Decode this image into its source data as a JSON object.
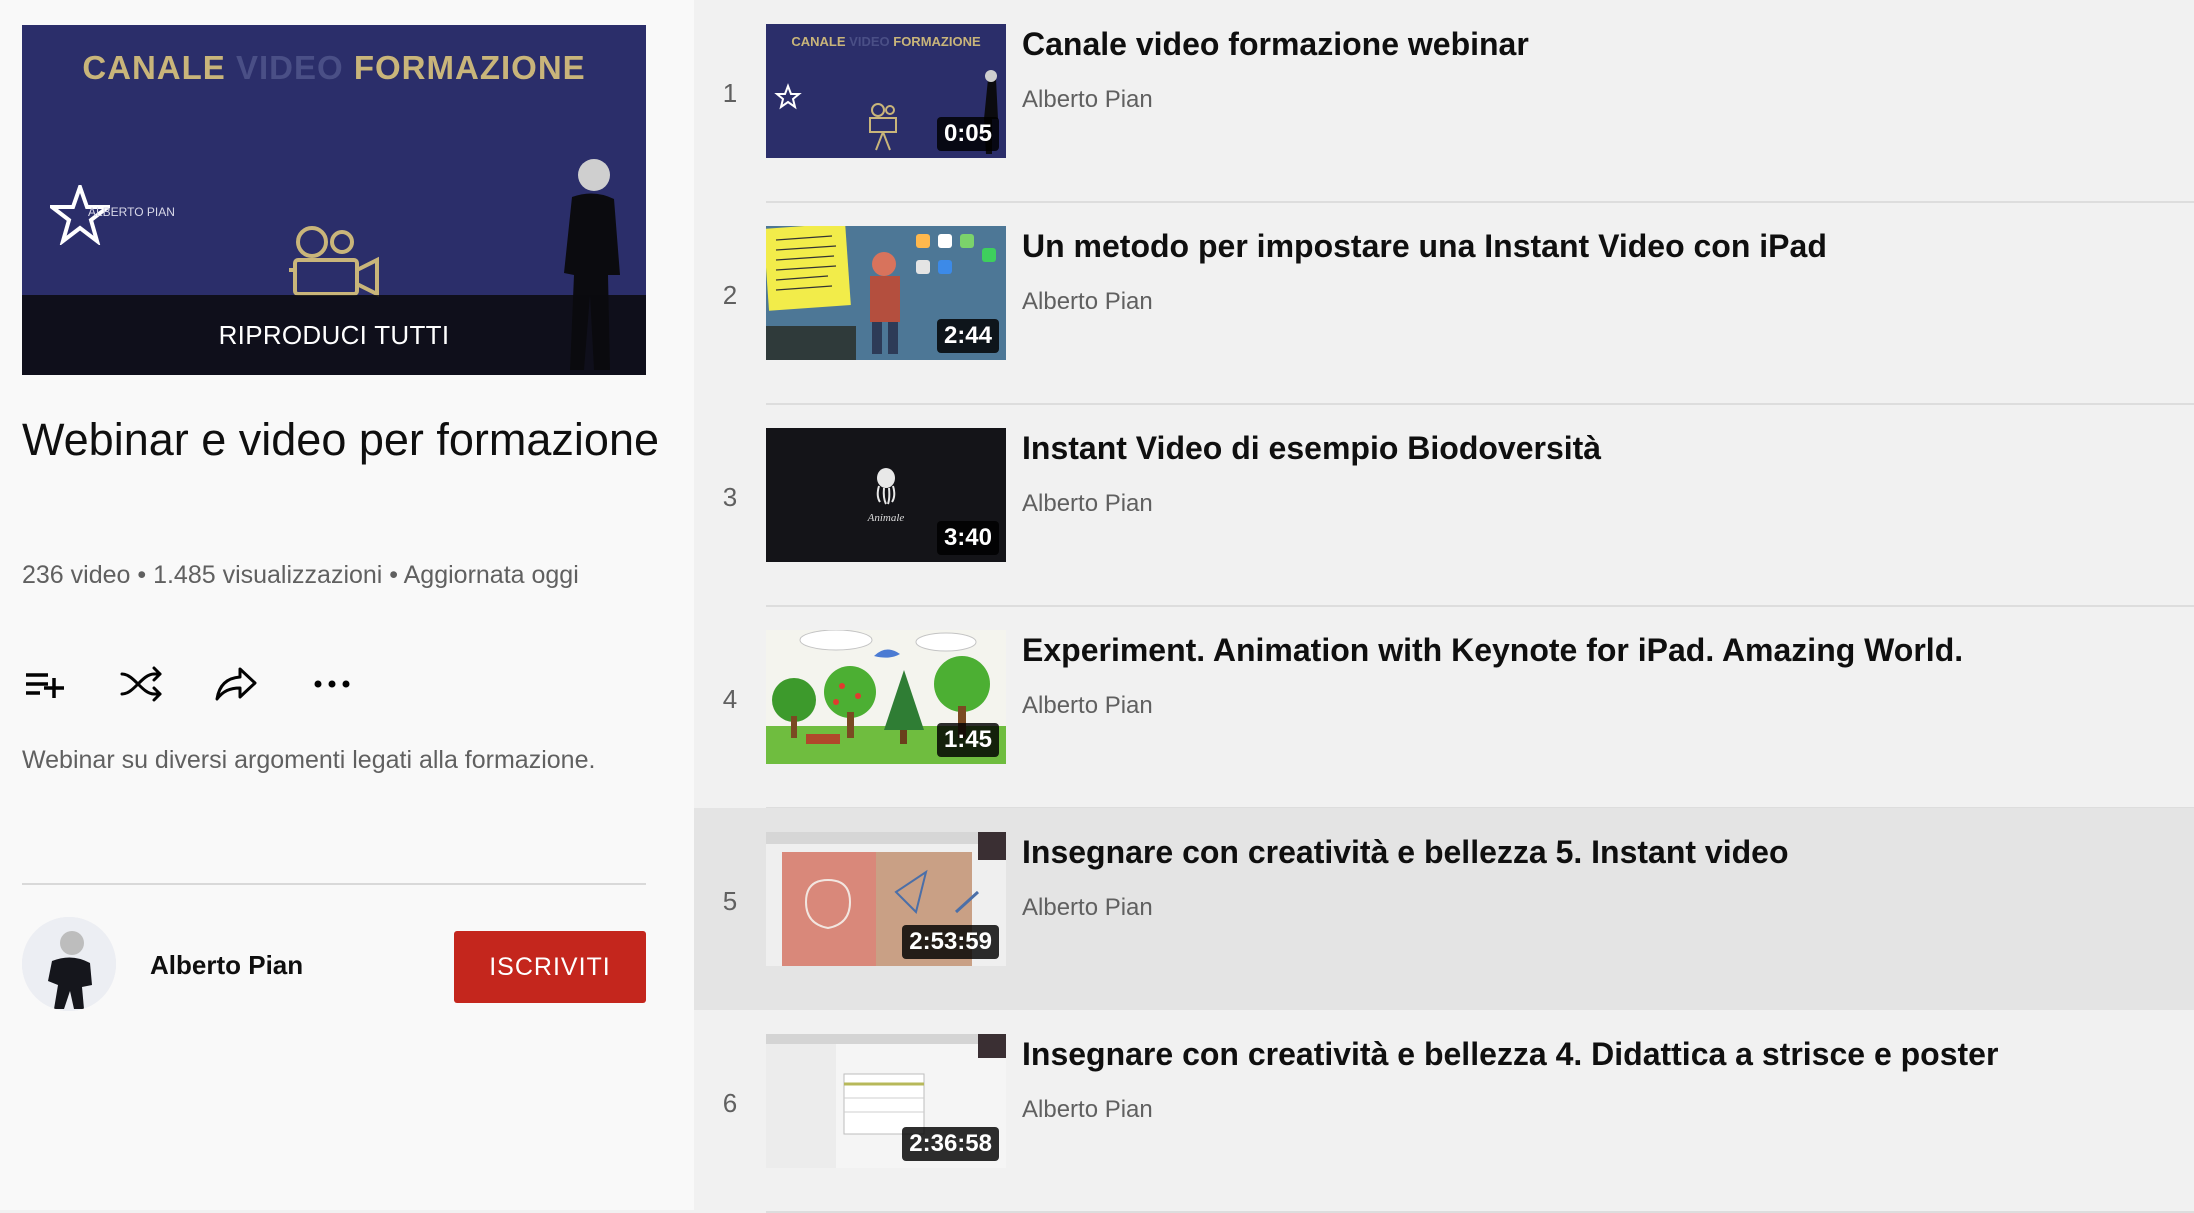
{
  "playlist": {
    "hero": {
      "title_part1": "CANALE",
      "title_part2": "VIDEO",
      "title_part3": "FORMAZIONE",
      "brand": "ALBERTO PIAN",
      "play_all_label": "RIPRODUCI TUTTI"
    },
    "title": "Webinar e video per formazione",
    "meta": "236 video • 1.485 visualizzazioni • Aggiornata oggi",
    "description": "Webinar su diversi argomenti legati alla formazione.",
    "actions": [
      {
        "name": "add-to-queue",
        "icon": "playlist-add-icon"
      },
      {
        "name": "shuffle",
        "icon": "shuffle-icon"
      },
      {
        "name": "share",
        "icon": "share-icon"
      },
      {
        "name": "more",
        "icon": "more-horiz-icon"
      }
    ],
    "owner": {
      "name": "Alberto Pian",
      "subscribe_label": "ISCRIVITI"
    }
  },
  "videos": [
    {
      "index": "1",
      "title": "Canale video formazione webinar",
      "channel": "Alberto Pian",
      "duration": "0:05",
      "thumb_text_1": "CANALE",
      "thumb_text_2": "VIDEO",
      "thumb_text_3": "FORMAZIONE"
    },
    {
      "index": "2",
      "title": "Un metodo per impostare una Instant Video con iPad",
      "channel": "Alberto Pian",
      "duration": "2:44"
    },
    {
      "index": "3",
      "title": "Instant Video di esempio Biodoversità",
      "channel": "Alberto Pian",
      "duration": "3:40",
      "thumb_caption": "Animale"
    },
    {
      "index": "4",
      "title": "Experiment. Animation with Keynote for iPad. Amazing World.",
      "channel": "Alberto Pian",
      "duration": "1:45"
    },
    {
      "index": "5",
      "title": "Insegnare con creatività e bellezza 5. Instant video",
      "channel": "Alberto Pian",
      "duration": "2:53:59",
      "active": true
    },
    {
      "index": "6",
      "title": "Insegnare con creatività e bellezza 4. Didattica a strisce e poster",
      "channel": "Alberto Pian",
      "duration": "2:36:58"
    }
  ],
  "colors": {
    "subscribe": "#c4261d",
    "hero_bg": "#2b2e6a",
    "active_row": "#e4e4e4"
  }
}
